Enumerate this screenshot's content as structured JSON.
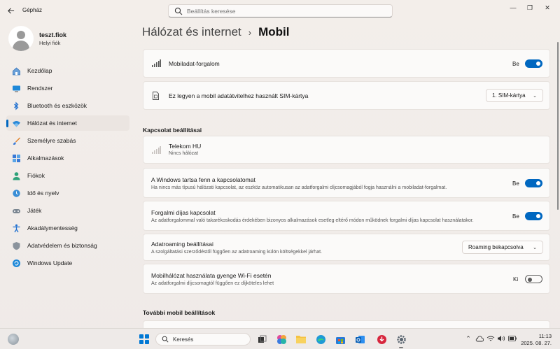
{
  "window": {
    "app_title": "Gépház",
    "search_placeholder": "Beállítás keresése",
    "minimize": "—",
    "maximize": "❐",
    "close": "✕"
  },
  "profile": {
    "name": "teszt.fiok",
    "account_type": "Helyi fiók"
  },
  "sidebar": {
    "items": [
      {
        "label": "Kezdőlap",
        "icon": "home-icon"
      },
      {
        "label": "Rendszer",
        "icon": "monitor-icon"
      },
      {
        "label": "Bluetooth és eszközök",
        "icon": "bluetooth-icon"
      },
      {
        "label": "Hálózat és internet",
        "icon": "wifi-icon",
        "active": true
      },
      {
        "label": "Személyre szabás",
        "icon": "paintbrush-icon"
      },
      {
        "label": "Alkalmazások",
        "icon": "apps-icon"
      },
      {
        "label": "Fiókok",
        "icon": "person-icon"
      },
      {
        "label": "Idő és nyelv",
        "icon": "globe-clock-icon"
      },
      {
        "label": "Játék",
        "icon": "gamepad-icon"
      },
      {
        "label": "Akadálymentesség",
        "icon": "accessibility-icon"
      },
      {
        "label": "Adatvédelem és biztonság",
        "icon": "shield-icon"
      },
      {
        "label": "Windows Update",
        "icon": "update-icon"
      }
    ]
  },
  "breadcrumb": {
    "parent": "Hálózat és internet",
    "separator": "›",
    "current": "Mobil"
  },
  "main": {
    "mobile_data": {
      "title": "Mobiladat-forgalom",
      "state_label": "Be",
      "on": true
    },
    "sim": {
      "title": "Ez legyen a mobil adatátvitelhez használt SIM-kártya",
      "selected": "1. SIM-kártya"
    },
    "connection_section": "Kapcsolat beállításai",
    "carrier": {
      "name": "Telekom HU",
      "status": "Nincs hálózat"
    },
    "keep_connected": {
      "title": "A Windows tartsa fenn a kapcsolatomat",
      "desc": "Ha nincs más típusú hálózati kapcsolat, az eszköz automatikusan az adatforgalmi díjcsomagjából fogja használni a mobiladat-forgalmat.",
      "state_label": "Be",
      "on": true
    },
    "metered": {
      "title": "Forgalmi díjas kapcsolat",
      "desc": "Az adatforgalommal való takarékoskodás érdekében bizonyos alkalmazások esetleg eltérő módon működnek forgalmi díjas kapcsolat használatakor.",
      "state_label": "Be",
      "on": true
    },
    "roaming": {
      "title": "Adatroaming beállításai",
      "desc": "A szolgáltatási szerződéstől függően az adatroaming külön költségekkel járhat.",
      "selected": "Roaming bekapcsolva"
    },
    "weak_wifi": {
      "title": "Mobilhálózat használata gyenge Wi-Fi esetén",
      "desc": "Az adatforgalmi díjcsomagtól függően ez díjköteles lehet",
      "state_label": "Ki",
      "on": false
    },
    "more_section": "További mobil beállítások"
  },
  "taskbar": {
    "search_label": "Keresés",
    "time": "11:13",
    "date": "2025. 08. 27."
  },
  "colors": {
    "accent": "#0067c0"
  }
}
